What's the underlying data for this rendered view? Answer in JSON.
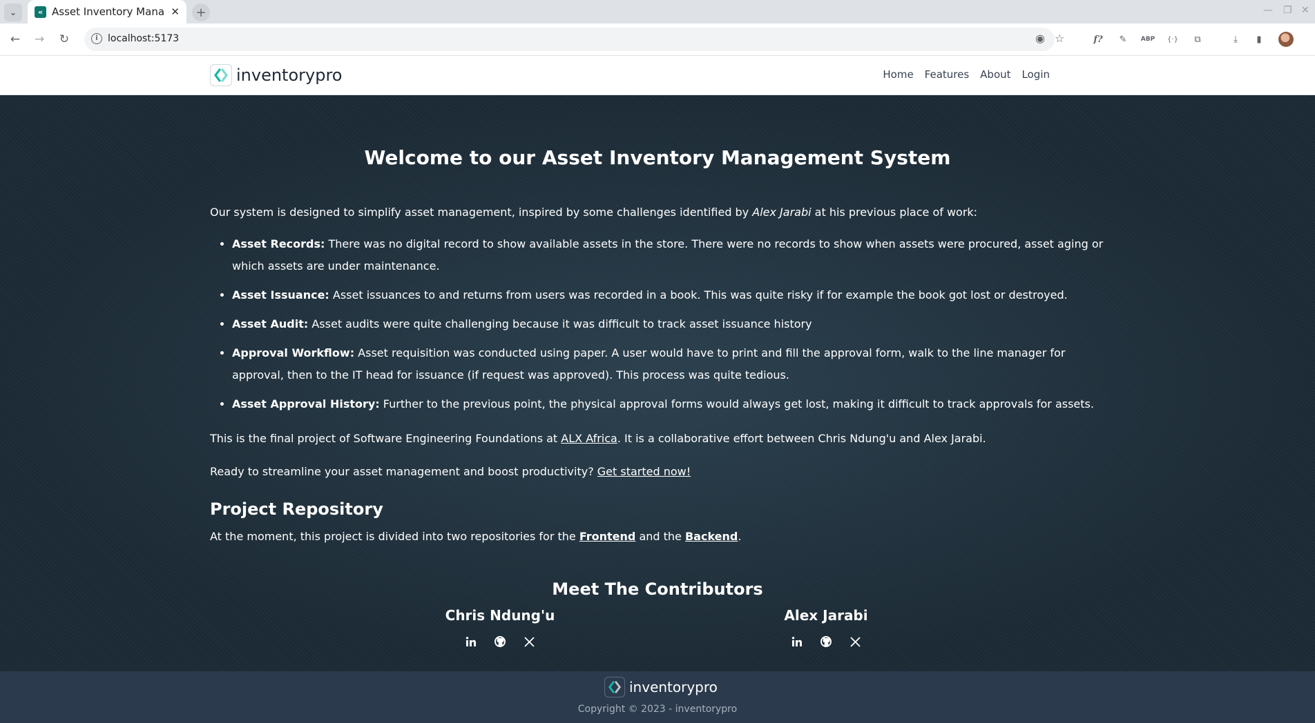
{
  "browser": {
    "tab_title": "Asset Inventory Management",
    "url": "localhost:5173"
  },
  "header": {
    "brand": "inventorypro",
    "nav": [
      "Home",
      "Features",
      "About",
      "Login"
    ]
  },
  "main": {
    "heading": "Welcome to our Asset Inventory Management System",
    "intro_before": "Our system is designed to simplify asset management, inspired by some challenges identified by ",
    "intro_name": "Alex Jarabi",
    "intro_after": " at his previous place of work:",
    "issues": [
      {
        "title": "Asset Records:",
        "text": " There was no digital record to show available assets in the store. There were no records to show when assets were procured, asset aging or which assets are under maintenance."
      },
      {
        "title": "Asset Issuance:",
        "text": " Asset issuances to and returns from users was recorded in a book. This was quite risky if for example the book got lost or destroyed."
      },
      {
        "title": "Asset Audit:",
        "text": " Asset audits were quite challenging because it was difficult to track asset issuance history"
      },
      {
        "title": "Approval Workflow:",
        "text": " Asset requisition was conducted using paper. A user would have to print and fill the approval form, walk to the line manager for approval, then to the IT head for issuance (if request was approved). This process was quite tedious."
      },
      {
        "title": "Asset Approval History:",
        "text": " Further to the previous point, the physical approval forms would always get lost, making it difficult to track approvals for assets."
      }
    ],
    "final_before": "This is the final project of Software Engineering Foundations at ",
    "final_link": "ALX Africa",
    "final_after": ". It is a collaborative effort between Chris Ndung'u and Alex Jarabi.",
    "ready_text": "Ready to streamline your asset management and boost productivity? ",
    "ready_link": "Get started now!",
    "repo_heading": "Project Repository",
    "repo_before": "At the moment, this project is divided into two repositories for the ",
    "repo_frontend": "Frontend",
    "repo_mid": " and the ",
    "repo_backend": "Backend",
    "repo_after": ".",
    "contributors_heading": "Meet The Contributors",
    "contributors": [
      {
        "name": "Chris Ndung'u"
      },
      {
        "name": "Alex Jarabi"
      }
    ]
  },
  "footer": {
    "brand": "inventorypro",
    "copyright": "Copyright © 2023 - inventorypro"
  },
  "colors": {
    "main_bg": "#1b2a35",
    "footer_bg": "#2b3a4c",
    "logo_teal": "#14b8a6"
  },
  "icons": [
    "search-icon",
    "linkedin-icon",
    "github-icon",
    "x-icon"
  ]
}
